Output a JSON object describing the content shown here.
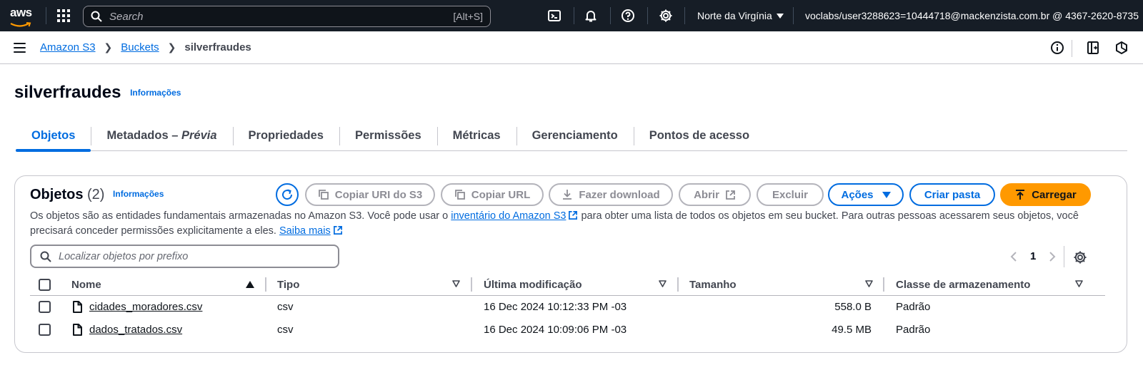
{
  "topnav": {
    "logo": "aws",
    "search_placeholder": "Search",
    "search_shortcut": "[Alt+S]",
    "region": "Norte da Virgínia",
    "account": "voclabs/user3288623=10444718@mackenzista.com.br @ 4367-2620-8735",
    "icons": [
      "cloudshell-icon",
      "bell-icon",
      "help-icon",
      "settings-icon"
    ]
  },
  "breadcrumb": {
    "items": [
      "Amazon S3",
      "Buckets"
    ],
    "current": "silverfraudes"
  },
  "page": {
    "title": "silverfraudes",
    "info": "Informações"
  },
  "tabs": [
    {
      "label_main": "Objetos",
      "label_em": "",
      "active": true
    },
    {
      "label_main": "Metadados – ",
      "label_em": "Prévia",
      "active": false
    },
    {
      "label_main": "Propriedades",
      "label_em": "",
      "active": false
    },
    {
      "label_main": "Permissões",
      "label_em": "",
      "active": false
    },
    {
      "label_main": "Métricas",
      "label_em": "",
      "active": false
    },
    {
      "label_main": "Gerenciamento",
      "label_em": "",
      "active": false
    },
    {
      "label_main": "Pontos de acesso",
      "label_em": "",
      "active": false
    }
  ],
  "objects": {
    "title": "Objetos",
    "count": "(2)",
    "info": "Informações",
    "buttons": {
      "copy_uri": "Copiar URI do S3",
      "copy_url": "Copiar URL",
      "download": "Fazer download",
      "open": "Abrir",
      "delete": "Excluir",
      "actions": "Ações",
      "create_folder": "Criar pasta",
      "upload": "Carregar"
    },
    "desc_part1": "Os objetos são as entidades fundamentais armazenadas no Amazon S3. Você pode usar o ",
    "desc_link1": "inventário do Amazon S3",
    "desc_part2": " para obter uma lista de todos os objetos em seu bucket. Para outras pessoas acessarem seus objetos, você precisará conceder permissões explicitamente a eles. ",
    "desc_link2": "Saiba mais",
    "filter_placeholder": "Localizar objetos por prefixo",
    "page_number": "1",
    "columns": [
      "Nome",
      "Tipo",
      "Última modificação",
      "Tamanho",
      "Classe de armazenamento"
    ],
    "rows": [
      {
        "name": "cidades_moradores.csv",
        "type": "csv",
        "modified": "16 Dec 2024 10:12:33 PM -03",
        "size": "558.0 B",
        "class": "Padrão"
      },
      {
        "name": "dados_tratados.csv",
        "type": "csv",
        "modified": "16 Dec 2024 10:09:06 PM -03",
        "size": "49.5 MB",
        "class": "Padrão"
      }
    ]
  },
  "colors": {
    "nav_bg": "#161d26",
    "link": "#006ce0",
    "primary": "#ff9900",
    "border": "#c6c6cd"
  }
}
